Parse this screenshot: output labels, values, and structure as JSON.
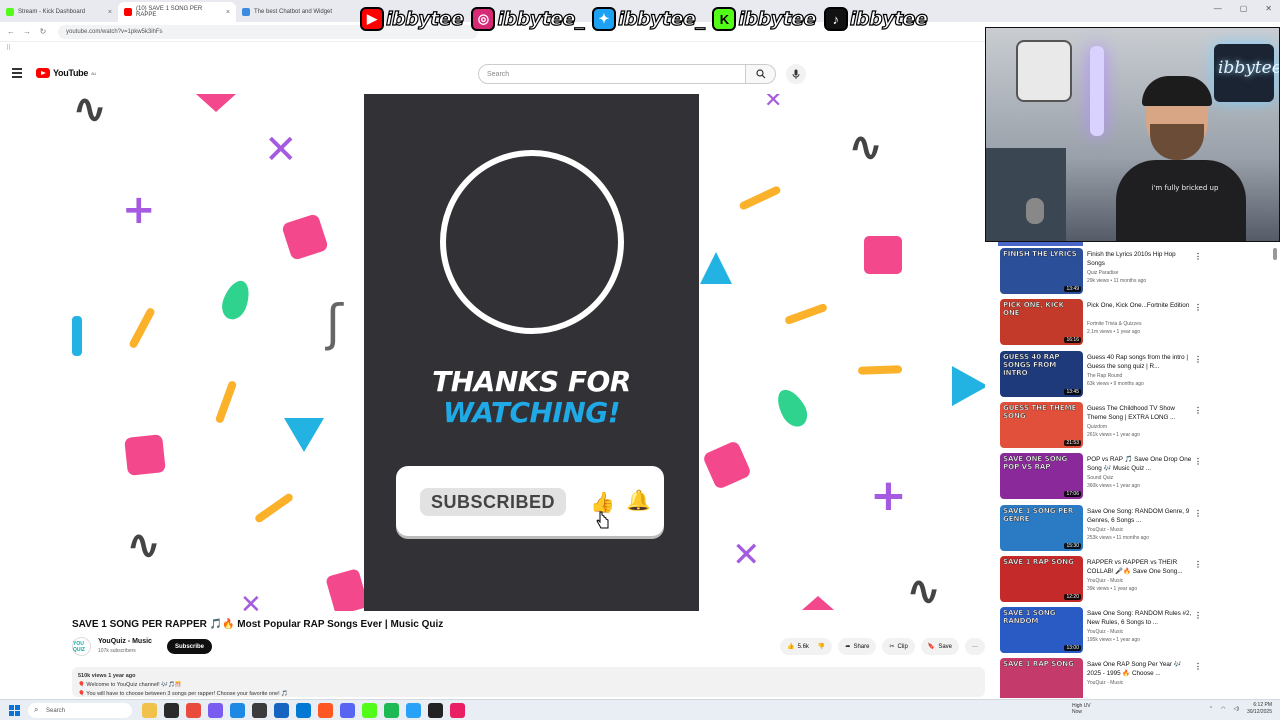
{
  "browser": {
    "tabs": [
      {
        "label": "Stream - Kick Dashboard",
        "color": "#53fc18",
        "active": false
      },
      {
        "label": "(10) SAVE 1 SONG PER RAPPE",
        "color": "#ff0000",
        "active": true
      },
      {
        "label": "The best Chatbot and Widget",
        "color": "#3a8dde",
        "active": false
      }
    ],
    "tab_close": "×",
    "url": "youtube.com/watch?v=1pkw5k3ihFs"
  },
  "overlay": {
    "handles": [
      {
        "platform": "youtube-icon",
        "glyph": "▶",
        "bg": "#ff0000",
        "text": "ibbytee"
      },
      {
        "platform": "instagram-icon",
        "glyph": "◎",
        "bg": "#d62976",
        "text": "ibbytee_"
      },
      {
        "platform": "twitter-icon",
        "glyph": "✦",
        "bg": "#1da1f2",
        "text": "ibbytee_"
      },
      {
        "platform": "kick-icon",
        "glyph": "K",
        "bg": "#53fc18",
        "text": "ibbytee"
      },
      {
        "platform": "tiktok-icon",
        "glyph": "♪",
        "bg": "#111111",
        "text": "ibbytee"
      }
    ]
  },
  "youtube": {
    "logo_text": "YouTube",
    "logo_sup": "AU",
    "search_placeholder": "Search",
    "search_icon": "search-icon",
    "mic_icon": "mic-icon"
  },
  "video_frame": {
    "thanks_line1": "THANKS FOR",
    "thanks_line2": "WATCHING!",
    "subscribed_label": "SUBSCRIBED",
    "accent_blue": "#1fa9e6",
    "card_bg": "#323135"
  },
  "video": {
    "title": "SAVE 1 SONG PER RAPPER 🎵🔥 Most Popular RAP Songs Ever | Music Quiz",
    "channel": {
      "avatar_text": "YOU QUIZ",
      "name": "YouQuiz - Music",
      "subscribers": "107k subscribers",
      "subscribe_label": "Subscribe"
    },
    "actions": {
      "likes": "5.6k",
      "share": "Share",
      "clip": "Clip",
      "save": "Save",
      "more": "···"
    },
    "description": {
      "views": "510k views  1 year ago",
      "line1": "🎈 Welcome to YouQuiz channel! 🎶🎵🎊",
      "line2": "🎈 You will have to choose between 3 songs per rapper! Choose your favorite one! 🎵"
    }
  },
  "webcam": {
    "neon_text": "ibbytee",
    "shirt_text": "i'm fully bricked up"
  },
  "recommended": [
    {
      "thumb_text": "FINISH THE LYRICS",
      "thumb_bg": "#2c4f99",
      "duration": "13:49",
      "title": "Finish the Lyrics 2010s Hip Hop Songs",
      "channel": "Quiz Paradise",
      "meta": "29k views • 11 months ago"
    },
    {
      "thumb_text": "PICK ONE, KICK ONE",
      "thumb_bg": "#c43a2a",
      "duration": "16:16",
      "title": "Pick One, Kick One...Fortnite Edition",
      "channel": "Fortnite Trivia & Quizzes",
      "meta": "2.1m views • 1 year ago"
    },
    {
      "thumb_text": "GUESS 40 RAP SONGS FROM INTRO",
      "thumb_bg": "#1e3a7a",
      "duration": "13:45",
      "title": "Guess 40 Rap songs from the intro | Guess the song quiz | R...",
      "channel": "The Rap Round",
      "meta": "63k views • 9 months ago"
    },
    {
      "thumb_text": "GUESS THE THEME SONG",
      "thumb_bg": "#e0503a",
      "duration": "21:53",
      "title": "Guess The Childhood TV Show Theme Song | EXTRA LONG ...",
      "channel": "Quizdom",
      "meta": "261k views • 1 year ago"
    },
    {
      "thumb_text": "SAVE ONE SONG POP VS RAP",
      "thumb_bg": "#8a2a9a",
      "duration": "17:06",
      "title": "POP vs RAP 🎵 Save One Drop One Song 🎶 Music Quiz ...",
      "channel": "Sound Quiz",
      "meta": "360k views • 1 year ago"
    },
    {
      "thumb_text": "SAVE 1 SONG PER GENRE",
      "thumb_bg": "#2a7ac4",
      "duration": "15:30",
      "title": "Save One Song: RANDOM Genre, 9 Genres, 6 Songs ...",
      "channel": "YouQuiz - Music",
      "meta": "253k views • 11 months ago"
    },
    {
      "thumb_text": "SAVE 1 RAP SONG",
      "thumb_bg": "#c42a2a",
      "duration": "12:20",
      "title": "RAPPER vs RAPPER vs THEIR COLLAB! 🎤🔥 Save One Song...",
      "channel": "YouQuiz - Music",
      "meta": "39k views • 1 year ago"
    },
    {
      "thumb_text": "SAVE 1 SONG RANDOM",
      "thumb_bg": "#2a5ac4",
      "duration": "13:00",
      "title": "Save One Song: RANDOM Rules #2, New Rules, 6 Songs to ...",
      "channel": "YouQuiz - Music",
      "meta": "195k views • 1 year ago"
    },
    {
      "thumb_text": "SAVE 1 RAP SONG",
      "thumb_bg": "#c43a6a",
      "duration": "",
      "title": "Save One RAP Song Per Year 🎶 2025 - 1995 🔥 Choose ...",
      "channel": "YouQuiz - Music",
      "meta": ""
    }
  ],
  "more_icon": "⋮",
  "taskbar": {
    "search_placeholder": "Search",
    "weather_line1": "High UV",
    "weather_line2": "Now",
    "time": "6:12 PM",
    "date": "30/12/2025"
  }
}
